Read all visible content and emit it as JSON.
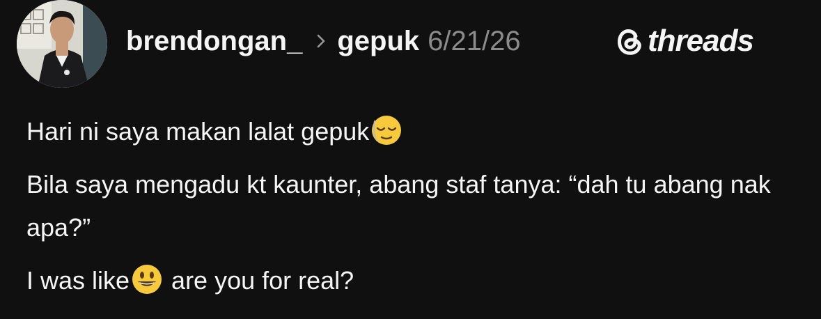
{
  "header": {
    "username": "brendongan_",
    "separator_icon": "chevron-right-icon",
    "community": "gepuk",
    "date": "6/21/26"
  },
  "brand": {
    "icon": "threads-logo-icon",
    "name": "threads"
  },
  "post": {
    "line1": "Hari ni saya makan lalat gepuk",
    "line1_emoji": "relieved-face-emoji",
    "line2": "Bila saya mengadu kt kaunter, abang staf tanya: “dah tu abang nak apa?”",
    "line3_start": "I was like",
    "line3_emoji": "grinning-face-emoji",
    "line3_end": " are you for real?"
  },
  "colors": {
    "background": "#111011",
    "text": "#f5f5f5",
    "muted": "#8c8c8c"
  }
}
